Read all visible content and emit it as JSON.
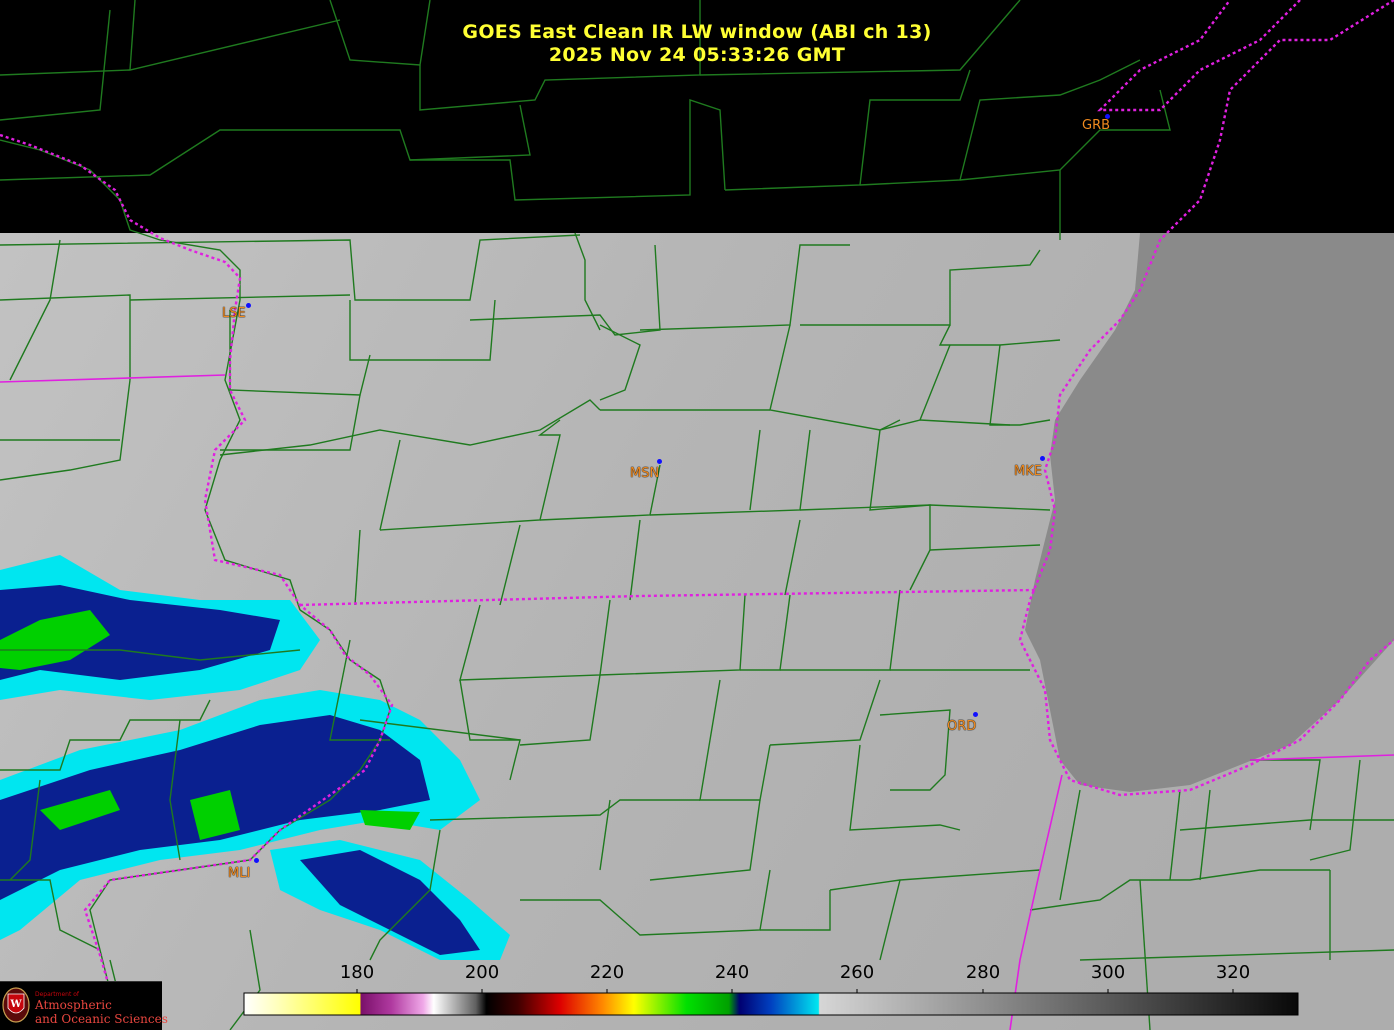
{
  "title": {
    "line1": "GOES East Clean IR LW window (ABI ch 13)",
    "line2": "2025 Nov 24  05:33:26 GMT"
  },
  "stations": [
    {
      "id": "GRB",
      "name": "GRB"
    },
    {
      "id": "LSE",
      "name": "LSE"
    },
    {
      "id": "MSN",
      "name": "MSN"
    },
    {
      "id": "MKE",
      "name": "MKE"
    },
    {
      "id": "ORD",
      "name": "ORD"
    },
    {
      "id": "MLI",
      "name": "MLI"
    }
  ],
  "colorbar": {
    "ticks": [
      "180",
      "200",
      "220",
      "240",
      "260",
      "280",
      "300",
      "320"
    ],
    "range": [
      163,
      331
    ],
    "colors": {
      "cold_start": "#ffffff",
      "yellow": "#ffff00",
      "magenta": "#a0208f",
      "pink": "#f0a0e0",
      "dark": "#1a0000",
      "red": "#dd0000",
      "orange": "#ff8800",
      "green": "#00c800",
      "navy": "#00006e",
      "cyan": "#00e6f0",
      "gray_light": "#d8d8d8",
      "black_end": "#080808"
    }
  },
  "colors": {
    "county_lines": "#1f7a1f",
    "state_lines": "#e020e0",
    "lake": "#8a8a8a",
    "land_ir": "#b4b4b4",
    "no_data": "#000000",
    "station_label": "#f08a1e",
    "station_dot": "#1010ff",
    "title": "#ffff33"
  },
  "logo": {
    "dept": "Department of",
    "name1": "Atmospheric",
    "name2": "and Oceanic Sciences"
  }
}
